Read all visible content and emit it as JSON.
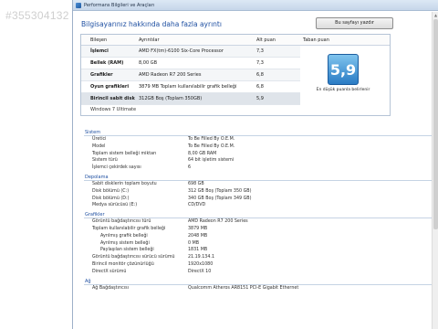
{
  "watermark": "#355304132",
  "window": {
    "title": "Performans Bilgileri ve Araçları"
  },
  "heading": "Bilgisayarınız hakkında daha fazla ayrıntı",
  "print_button": "Bu sayfayı yazdır",
  "score_table": {
    "columns": [
      "Bileşen",
      "Ayrıntılar",
      "Alt puan",
      "Taban puan"
    ],
    "rows": [
      {
        "component": "İşlemci",
        "details": "AMD FX(tm)-6100 Six-Core Processor",
        "subscore": "7,3"
      },
      {
        "component": "Bellek (RAM)",
        "details": "8,00 GB",
        "subscore": "7,3"
      },
      {
        "component": "Grafikler",
        "details": "AMD Radeon R7 200 Series",
        "subscore": "6,8"
      },
      {
        "component": "Oyun grafikleri",
        "details": "3879 MB Toplam kullanılabilir grafik belleği",
        "subscore": "6,8"
      },
      {
        "component": "Birincil sabit disk",
        "details": "312GB Boş (Toplam 350GB)",
        "subscore": "5,9"
      }
    ],
    "base_score": "5,9",
    "base_caption": "En düşük puanla belirlenir",
    "os": "Windows 7 Ultimate"
  },
  "sections": [
    {
      "title": "Sistem",
      "rows": [
        {
          "k": "Üretici",
          "v": "To Be Filled By O.E.M."
        },
        {
          "k": "Model",
          "v": "To Be Filled By O.E.M."
        },
        {
          "k": "Toplam sistem belleği miktarı",
          "v": "8,00 GB RAM"
        },
        {
          "k": "Sistem türü",
          "v": "64 bit işletim sistemi"
        },
        {
          "k": "İşlemci çekirdek sayısı",
          "v": "6"
        }
      ]
    },
    {
      "title": "Depolama",
      "rows": [
        {
          "k": "Sabit disklerin toplam boyutu",
          "v": "698 GB"
        },
        {
          "k": "Disk bölümü (C:)",
          "v": "312 GB Boş (Toplam 350 GB)"
        },
        {
          "k": "Disk bölümü (D:)",
          "v": "340 GB Boş (Toplam 349 GB)"
        },
        {
          "k": "Medya sürücüsü (E:)",
          "v": "CD/DVD"
        }
      ]
    },
    {
      "title": "Grafikler",
      "rows": [
        {
          "k": "Görüntü bağdaştırıcısı türü",
          "v": "AMD Radeon R7 200 Series"
        },
        {
          "k": "Toplam kullanılabilir grafik belleği",
          "v": "3879 MB"
        },
        {
          "k": "Ayrılmış grafik belleği",
          "v": "2048 MB",
          "sub": true
        },
        {
          "k": "Ayrılmış sistem belleği",
          "v": "0 MB",
          "sub": true
        },
        {
          "k": "Paylaşılan sistem belleği",
          "v": "1831 MB",
          "sub": true
        },
        {
          "k": "Görüntü bağdaştırıcısı sürücü sürümü",
          "v": "21.19.134.1"
        },
        {
          "k": "Birincil monitör çözünürlüğü",
          "v": "1920x1080"
        },
        {
          "k": "DirectX sürümü",
          "v": "DirectX 10"
        }
      ]
    },
    {
      "title": "Ağ",
      "rows": [
        {
          "k": "Ağ Bağdaştırıcısı",
          "v": "Qualcomm Atheros AR8151 PCI-E Gigabit Ethernet"
        }
      ]
    }
  ]
}
